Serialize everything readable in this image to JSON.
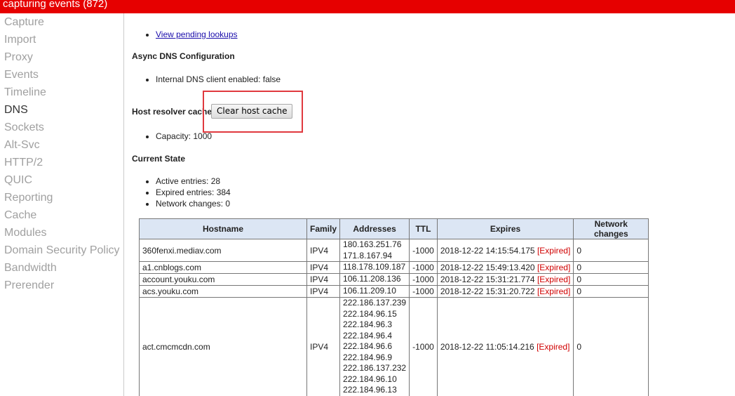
{
  "topbar": {
    "title": "capturing events (872)"
  },
  "sidebar": {
    "items": [
      {
        "label": "Capture"
      },
      {
        "label": "Import"
      },
      {
        "label": "Proxy"
      },
      {
        "label": "Events"
      },
      {
        "label": "Timeline"
      },
      {
        "label": "DNS"
      },
      {
        "label": "Sockets"
      },
      {
        "label": "Alt-Svc"
      },
      {
        "label": "HTTP/2"
      },
      {
        "label": "QUIC"
      },
      {
        "label": "Reporting"
      },
      {
        "label": "Cache"
      },
      {
        "label": "Modules"
      },
      {
        "label": "Domain Security Policy"
      },
      {
        "label": "Bandwidth"
      },
      {
        "label": "Prerender"
      }
    ],
    "active": "DNS"
  },
  "main": {
    "pending_link": "View pending lookups",
    "async_heading": "Async DNS Configuration",
    "internal_dns": "Internal DNS client enabled: false",
    "resolver_heading": "Host resolver cache",
    "clear_button": "Clear host cache",
    "capacity": "Capacity: 1000",
    "state_heading": "Current State",
    "active_entries": "Active entries: 28",
    "expired_entries": "Expired entries: 384",
    "network_changes": "Network changes: 0",
    "highlight_color": "#e0393e"
  },
  "table": {
    "headers": [
      "Hostname",
      "Family",
      "Addresses",
      "TTL",
      "Expires",
      "Network changes"
    ],
    "expired_label": "[Expired]",
    "rows": [
      {
        "hostname": "360fenxi.mediav.com",
        "family": "IPV4",
        "addresses": [
          "180.163.251.76",
          "171.8.167.94"
        ],
        "ttl": "-1000",
        "expires": "2018-12-22 14:15:54.175",
        "changes": "0"
      },
      {
        "hostname": "a1.cnblogs.com",
        "family": "IPV4",
        "addresses": [
          "118.178.109.187"
        ],
        "ttl": "-1000",
        "expires": "2018-12-22 15:49:13.420",
        "changes": "0"
      },
      {
        "hostname": "account.youku.com",
        "family": "IPV4",
        "addresses": [
          "106.11.208.136"
        ],
        "ttl": "-1000",
        "expires": "2018-12-22 15:31:21.774",
        "changes": "0"
      },
      {
        "hostname": "acs.youku.com",
        "family": "IPV4",
        "addresses": [
          "106.11.209.10"
        ],
        "ttl": "-1000",
        "expires": "2018-12-22 15:31:20.722",
        "changes": "0"
      },
      {
        "hostname": "act.cmcmcdn.com",
        "family": "IPV4",
        "addresses": [
          "222.186.137.239",
          "222.184.96.15",
          "222.184.96.3",
          "222.184.96.4",
          "222.184.96.6",
          "222.184.96.9",
          "222.186.137.232",
          "222.184.96.10",
          "222.184.96.13"
        ],
        "ttl": "-1000",
        "expires": "2018-12-22 11:05:14.216",
        "changes": "0"
      }
    ]
  }
}
